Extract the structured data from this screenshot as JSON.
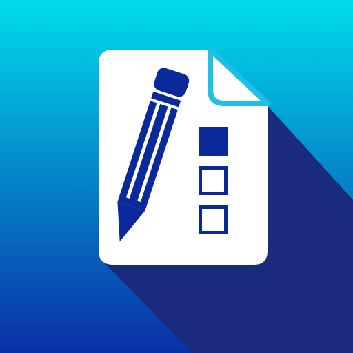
{
  "icon": {
    "name": "form-editor-app-icon",
    "glyphs": [
      "document-icon",
      "pencil-icon",
      "checkbox-list-icon"
    ],
    "colors": {
      "background_top": "#00DCEB",
      "background_bottom": "#0A2FA8",
      "shadow": "#1A2A7C",
      "paper": "#FFFFFF",
      "fold_edge": "#1FBFE6",
      "ink": "#0A2A9C"
    },
    "checklist": {
      "items": [
        {
          "checked": true
        },
        {
          "checked": false
        },
        {
          "checked": false
        }
      ]
    }
  }
}
